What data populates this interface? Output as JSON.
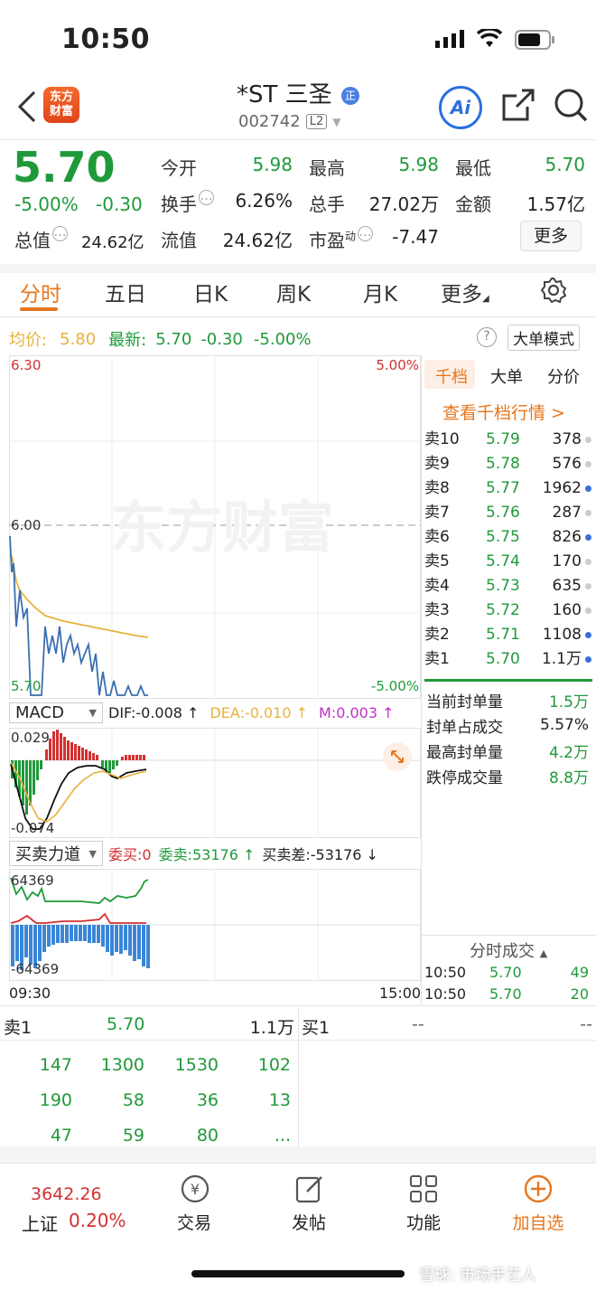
{
  "status_bar": {
    "time": "10:50"
  },
  "header": {
    "logo_line1": "东方",
    "logo_line2": "财富",
    "stock_name": "*ST 三圣",
    "name_badge": "正",
    "stock_code": "002742",
    "level_badge": "L2",
    "ai_label": "Ai"
  },
  "quote": {
    "price": "5.70",
    "change_pct": "-5.00%",
    "change_abs": "-0.30",
    "open_label": "今开",
    "open": "5.98",
    "high_label": "最高",
    "high": "5.98",
    "low_label": "最低",
    "low": "5.70",
    "turnover_label": "换手",
    "turnover": "6.26%",
    "volume_label": "总手",
    "volume": "27.02万",
    "amount_label": "金额",
    "amount": "1.57亿",
    "mktcap_label": "总值",
    "mktcap": "24.62亿",
    "float_label": "流值",
    "float_cap": "24.62亿",
    "pe_label": "市盈",
    "pe_sup": "动",
    "pe": "-7.47",
    "more_label": "更多"
  },
  "tabs": [
    "分时",
    "五日",
    "日K",
    "周K",
    "月K",
    "更多"
  ],
  "intraday": {
    "avg_label": "均价:",
    "avg": "5.80",
    "latest_label": "最新:",
    "latest": "5.70",
    "latest_chg": "-0.30",
    "latest_pct": "-5.00%",
    "mode_label": "大单模式",
    "y_top": "6.30",
    "y_mid": "6.00",
    "y_bot": "5.70",
    "pct_top": "5.00%",
    "pct_bot": "-5.00%",
    "watermark": "东方财富",
    "time_start": "09:30",
    "time_end": "15:00"
  },
  "macd": {
    "selector": "MACD",
    "dif": "DIF:-0.008 ↑",
    "dea": "DEA:-0.010 ↑",
    "m": "M:0.003 ↑",
    "y_top": "0.029",
    "y_bot": "-0.074"
  },
  "force": {
    "selector": "买卖力道",
    "bid": "委买:0",
    "ask": "委卖:53176 ↑",
    "diff": "买卖差:-53176 ↓",
    "y_top": "64369",
    "y_bot": "-64369"
  },
  "orderbook": {
    "tabs": [
      "千档",
      "大单",
      "分价"
    ],
    "link": "查看千档行情 >",
    "rows": [
      {
        "label": "卖10",
        "price": "5.79",
        "vol": "378",
        "dot": "#cccccc"
      },
      {
        "label": "卖9",
        "price": "5.78",
        "vol": "576",
        "dot": "#cccccc"
      },
      {
        "label": "卖8",
        "price": "5.77",
        "vol": "1962",
        "dot": "#3a6fd8"
      },
      {
        "label": "卖7",
        "price": "5.76",
        "vol": "287",
        "dot": "#cccccc"
      },
      {
        "label": "卖6",
        "price": "5.75",
        "vol": "826",
        "dot": "#3a6fd8"
      },
      {
        "label": "卖5",
        "price": "5.74",
        "vol": "170",
        "dot": "#cccccc"
      },
      {
        "label": "卖4",
        "price": "5.73",
        "vol": "635",
        "dot": "#cccccc"
      },
      {
        "label": "卖3",
        "price": "5.72",
        "vol": "160",
        "dot": "#cccccc"
      },
      {
        "label": "卖2",
        "price": "5.71",
        "vol": "1108",
        "dot": "#3a6fd8"
      },
      {
        "label": "卖1",
        "price": "5.70",
        "vol": "1.1万",
        "dot": "#3a6fd8"
      }
    ],
    "stats": [
      {
        "label": "当前封单量",
        "value": "1.5万"
      },
      {
        "label": "封单占成交",
        "value": "5.57%"
      },
      {
        "label": "最高封单量",
        "value": "4.2万"
      },
      {
        "label": "跌停成交量",
        "value": "8.8万"
      }
    ],
    "ticks_title": "分时成交",
    "ticks": [
      {
        "time": "10:50",
        "price": "5.70",
        "vol": "49"
      },
      {
        "time": "10:50",
        "price": "5.70",
        "vol": "20"
      }
    ]
  },
  "queue": {
    "sell_label": "卖1",
    "sell_price": "5.70",
    "sell_vol": "1.1万",
    "buy_label": "买1",
    "buy_price": "--",
    "buy_vol": "--",
    "rows": [
      [
        "147",
        "1300",
        "1530",
        "102"
      ],
      [
        "190",
        "58",
        "36",
        "13"
      ],
      [
        "47",
        "59",
        "80",
        "..."
      ]
    ]
  },
  "bottom_nav": {
    "index_value": "3642.26",
    "index_name": "上证",
    "index_pct": "0.20%",
    "trade": "交易",
    "post": "发帖",
    "functions": "功能",
    "add_watch": "加自选",
    "watermark": "雪球: 市场手艺人"
  },
  "colors": {
    "up": "#d43030",
    "down": "#1f9a3a",
    "accent": "#e8761c",
    "avg_line": "#e8b23a",
    "price_line": "#3a6fb0"
  }
}
